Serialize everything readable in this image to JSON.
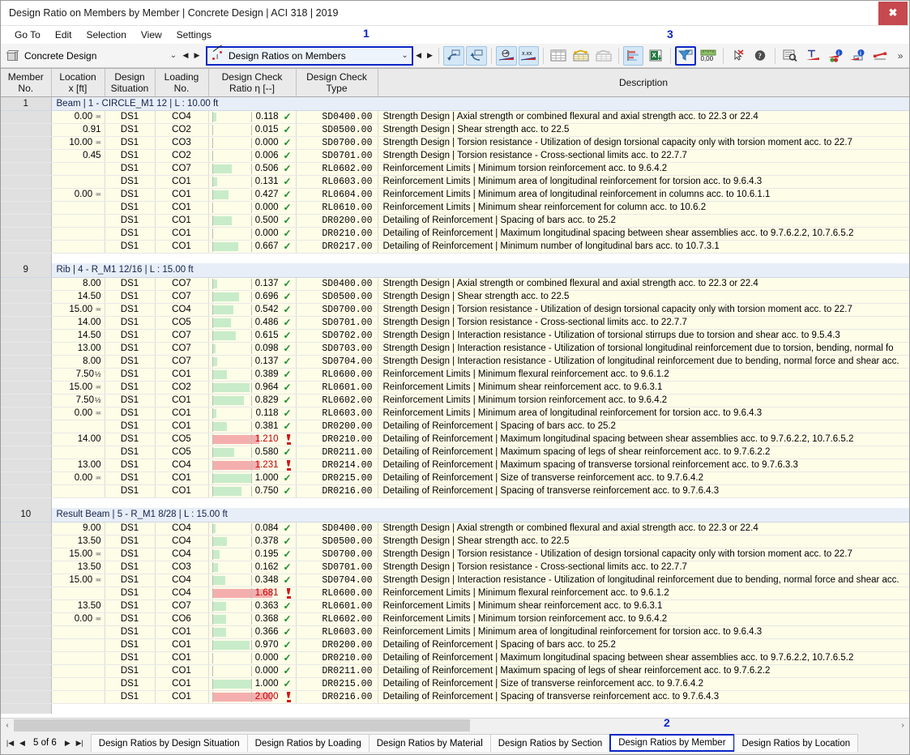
{
  "window": {
    "title": "Design Ratio on Members by Member | Concrete Design | ACI 318 | 2019",
    "close_label": "✖"
  },
  "menubar": {
    "items": [
      "Go To",
      "Edit",
      "Selection",
      "View",
      "Settings"
    ]
  },
  "callouts": {
    "one": "1",
    "two": "2",
    "three": "3"
  },
  "toolbar": {
    "module_combo": {
      "value": "Concrete Design",
      "chevron": "⌄",
      "prev": "◀",
      "next": "▶"
    },
    "table_combo": {
      "value": "Design Ratios on Members",
      "chevron": "⌄",
      "prev": "◀",
      "next": "▶"
    },
    "overflow": "»",
    "buttons": [
      "select-in-graphic-icon",
      "select-in-table-icon",
      "show-results-icon",
      "show-values-icon",
      "table-all-icon",
      "table-filled-icon",
      "table-empty-icon",
      "chart-icon",
      "export-excel-icon",
      "filter-icon",
      "decimal-places-icon",
      "deselect-icon",
      "help-icon",
      "find-icon",
      "units-icon",
      "info-colors-icon",
      "info-marker-icon",
      "reference-icon"
    ]
  },
  "table": {
    "columns": [
      {
        "id": "member_no",
        "label": "Member\nNo."
      },
      {
        "id": "location",
        "label": "Location\nx [ft]"
      },
      {
        "id": "design_situation",
        "label": "Design\nSituation"
      },
      {
        "id": "loading_no",
        "label": "Loading\nNo."
      },
      {
        "id": "design_check_ratio",
        "label": "Design Check\nRatio η [--]"
      },
      {
        "id": "design_check_type",
        "label": "Design Check\nType"
      },
      {
        "id": "description",
        "label": "Description"
      }
    ],
    "groups": [
      {
        "member_no": "1",
        "title": "Beam | 1 - CIRCLE_M1 12 | L : 10.00 ft",
        "rows": [
          {
            "loc": "0.00",
            "sym": "≖",
            "ds": "DS1",
            "lc": "CO4",
            "ratio": "0.118",
            "val": 0.118,
            "ok": true,
            "type": "SD0400.00",
            "desc": "Strength Design | Axial strength or combined flexural and axial strength acc. to 22.3 or 22.4"
          },
          {
            "loc": "0.91",
            "sym": "",
            "ds": "DS1",
            "lc": "CO2",
            "ratio": "0.015",
            "val": 0.015,
            "ok": true,
            "type": "SD0500.00",
            "desc": "Strength Design | Shear strength acc. to 22.5"
          },
          {
            "loc": "10.00",
            "sym": "≖",
            "ds": "DS1",
            "lc": "CO3",
            "ratio": "0.000",
            "val": 0.0,
            "ok": true,
            "type": "SD0700.00",
            "desc": "Strength Design | Torsion resistance - Utilization of design torsional capacity only with torsion moment acc. to 22.7"
          },
          {
            "loc": "0.45",
            "sym": "",
            "ds": "DS1",
            "lc": "CO2",
            "ratio": "0.006",
            "val": 0.006,
            "ok": true,
            "type": "SD0701.00",
            "desc": "Strength Design | Torsion resistance - Cross-sectional limits acc. to 22.7.7"
          },
          {
            "loc": "",
            "sym": "",
            "ds": "DS1",
            "lc": "CO7",
            "ratio": "0.506",
            "val": 0.506,
            "ok": true,
            "type": "RL0602.00",
            "desc": "Reinforcement Limits | Minimum torsion reinforcement acc. to 9.6.4.2"
          },
          {
            "loc": "",
            "sym": "",
            "ds": "DS1",
            "lc": "CO1",
            "ratio": "0.131",
            "val": 0.131,
            "ok": true,
            "type": "RL0603.00",
            "desc": "Reinforcement Limits | Minimum area of longitudinal reinforcement for torsion acc. to 9.6.4.3"
          },
          {
            "loc": "0.00",
            "sym": "≖",
            "ds": "DS1",
            "lc": "CO1",
            "ratio": "0.427",
            "val": 0.427,
            "ok": true,
            "type": "RL0604.00",
            "desc": "Reinforcement Limits | Minimum area of longitudinal reinforcement in columns acc. to 10.6.1.1"
          },
          {
            "loc": "",
            "sym": "",
            "ds": "DS1",
            "lc": "CO1",
            "ratio": "0.000",
            "val": 0.0,
            "ok": true,
            "type": "RL0610.00",
            "desc": "Reinforcement Limits | Minimum shear reinforcement for column acc. to 10.6.2"
          },
          {
            "loc": "",
            "sym": "",
            "ds": "DS1",
            "lc": "CO1",
            "ratio": "0.500",
            "val": 0.5,
            "ok": true,
            "type": "DR0200.00",
            "desc": "Detailing of Reinforcement | Spacing of bars acc. to 25.2"
          },
          {
            "loc": "",
            "sym": "",
            "ds": "DS1",
            "lc": "CO1",
            "ratio": "0.000",
            "val": 0.0,
            "ok": true,
            "type": "DR0210.00",
            "desc": "Detailing of Reinforcement | Maximum longitudinal spacing between shear assemblies acc. to 9.7.6.2.2, 10.7.6.5.2"
          },
          {
            "loc": "",
            "sym": "",
            "ds": "DS1",
            "lc": "CO1",
            "ratio": "0.667",
            "val": 0.667,
            "ok": true,
            "type": "DR0217.00",
            "desc": "Detailing of Reinforcement | Minimum number of longitudinal bars acc. to 10.7.3.1"
          }
        ]
      },
      {
        "member_no": "9",
        "title": "Rib | 4 - R_M1 12/16 | L : 15.00 ft",
        "rows": [
          {
            "loc": "8.00",
            "sym": "",
            "ds": "DS1",
            "lc": "CO7",
            "ratio": "0.137",
            "val": 0.137,
            "ok": true,
            "type": "SD0400.00",
            "desc": "Strength Design | Axial strength or combined flexural and axial strength acc. to 22.3 or 22.4"
          },
          {
            "loc": "14.50",
            "sym": "",
            "ds": "DS1",
            "lc": "CO7",
            "ratio": "0.696",
            "val": 0.696,
            "ok": true,
            "type": "SD0500.00",
            "desc": "Strength Design | Shear strength acc. to 22.5"
          },
          {
            "loc": "15.00",
            "sym": "≖",
            "ds": "DS1",
            "lc": "CO4",
            "ratio": "0.542",
            "val": 0.542,
            "ok": true,
            "type": "SD0700.00",
            "desc": "Strength Design | Torsion resistance - Utilization of design torsional capacity only with torsion moment acc. to 22.7"
          },
          {
            "loc": "14.00",
            "sym": "",
            "ds": "DS1",
            "lc": "CO5",
            "ratio": "0.486",
            "val": 0.486,
            "ok": true,
            "type": "SD0701.00",
            "desc": "Strength Design | Torsion resistance - Cross-sectional limits acc. to 22.7.7"
          },
          {
            "loc": "14.50",
            "sym": "",
            "ds": "DS1",
            "lc": "CO7",
            "ratio": "0.615",
            "val": 0.615,
            "ok": true,
            "type": "SD0702.00",
            "desc": "Strength Design | Interaction resistance - Utilization of torsional stirrups due to torsion and shear acc. to 9.5.4.3"
          },
          {
            "loc": "13.00",
            "sym": "",
            "ds": "DS1",
            "lc": "CO7",
            "ratio": "0.098",
            "val": 0.098,
            "ok": true,
            "type": "SD0703.00",
            "desc": "Strength Design | Interaction resistance - Utilization of torsional longitudinal reinforcement due to torsion, bending, normal fo"
          },
          {
            "loc": "8.00",
            "sym": "",
            "ds": "DS1",
            "lc": "CO7",
            "ratio": "0.137",
            "val": 0.137,
            "ok": true,
            "type": "SD0704.00",
            "desc": "Strength Design | Interaction resistance - Utilization of longitudinal reinforcement due to bending, normal force and shear acc."
          },
          {
            "loc": "7.50",
            "sym": "",
            "half": "½",
            "ds": "DS1",
            "lc": "CO1",
            "ratio": "0.389",
            "val": 0.389,
            "ok": true,
            "type": "RL0600.00",
            "desc": "Reinforcement Limits | Minimum flexural reinforcement acc. to 9.6.1.2"
          },
          {
            "loc": "15.00",
            "sym": "≖",
            "ds": "DS1",
            "lc": "CO2",
            "ratio": "0.964",
            "val": 0.964,
            "ok": true,
            "type": "RL0601.00",
            "desc": "Reinforcement Limits | Minimum shear reinforcement acc. to 9.6.3.1"
          },
          {
            "loc": "7.50",
            "sym": "",
            "half": "½",
            "ds": "DS1",
            "lc": "CO1",
            "ratio": "0.829",
            "val": 0.829,
            "ok": true,
            "type": "RL0602.00",
            "desc": "Reinforcement Limits | Minimum torsion reinforcement acc. to 9.6.4.2"
          },
          {
            "loc": "0.00",
            "sym": "≖",
            "ds": "DS1",
            "lc": "CO1",
            "ratio": "0.118",
            "val": 0.118,
            "ok": true,
            "type": "RL0603.00",
            "desc": "Reinforcement Limits | Minimum area of longitudinal reinforcement for torsion acc. to 9.6.4.3"
          },
          {
            "loc": "",
            "sym": "",
            "ds": "DS1",
            "lc": "CO1",
            "ratio": "0.381",
            "val": 0.381,
            "ok": true,
            "type": "DR0200.00",
            "desc": "Detailing of Reinforcement | Spacing of bars acc. to 25.2"
          },
          {
            "loc": "14.00",
            "sym": "",
            "ds": "DS1",
            "lc": "CO5",
            "ratio": "1.210",
            "val": 1.21,
            "ok": false,
            "type": "DR0210.00",
            "desc": "Detailing of Reinforcement | Maximum longitudinal spacing between shear assemblies acc. to 9.7.6.2.2, 10.7.6.5.2"
          },
          {
            "loc": "",
            "sym": "",
            "ds": "DS1",
            "lc": "CO5",
            "ratio": "0.580",
            "val": 0.58,
            "ok": true,
            "type": "DR0211.00",
            "desc": "Detailing of Reinforcement | Maximum spacing of legs of shear reinforcement acc. to 9.7.6.2.2"
          },
          {
            "loc": "13.00",
            "sym": "",
            "ds": "DS1",
            "lc": "CO4",
            "ratio": "1.231",
            "val": 1.231,
            "ok": false,
            "type": "DR0214.00",
            "desc": "Detailing of Reinforcement | Maximum spacing of transverse torsional reinforcement acc. to 9.7.6.3.3"
          },
          {
            "loc": "0.00",
            "sym": "≖",
            "ds": "DS1",
            "lc": "CO1",
            "ratio": "1.000",
            "val": 1.0,
            "ok": true,
            "type": "DR0215.00",
            "desc": "Detailing of Reinforcement | Size of transverse reinforcement acc. to 9.7.6.4.2"
          },
          {
            "loc": "",
            "sym": "",
            "ds": "DS1",
            "lc": "CO1",
            "ratio": "0.750",
            "val": 0.75,
            "ok": true,
            "type": "DR0216.00",
            "desc": "Detailing of Reinforcement | Spacing of transverse reinforcement acc. to 9.7.6.4.3"
          }
        ]
      },
      {
        "member_no": "10",
        "title": "Result Beam | 5 - R_M1 8/28 | L : 15.00 ft",
        "rows": [
          {
            "loc": "9.00",
            "sym": "",
            "ds": "DS1",
            "lc": "CO4",
            "ratio": "0.084",
            "val": 0.084,
            "ok": true,
            "type": "SD0400.00",
            "desc": "Strength Design | Axial strength or combined flexural and axial strength acc. to 22.3 or 22.4"
          },
          {
            "loc": "13.50",
            "sym": "",
            "ds": "DS1",
            "lc": "CO4",
            "ratio": "0.378",
            "val": 0.378,
            "ok": true,
            "type": "SD0500.00",
            "desc": "Strength Design | Shear strength acc. to 22.5"
          },
          {
            "loc": "15.00",
            "sym": "≖",
            "ds": "DS1",
            "lc": "CO4",
            "ratio": "0.195",
            "val": 0.195,
            "ok": true,
            "type": "SD0700.00",
            "desc": "Strength Design | Torsion resistance - Utilization of design torsional capacity only with torsion moment acc. to 22.7"
          },
          {
            "loc": "13.50",
            "sym": "",
            "ds": "DS1",
            "lc": "CO3",
            "ratio": "0.162",
            "val": 0.162,
            "ok": true,
            "type": "SD0701.00",
            "desc": "Strength Design | Torsion resistance - Cross-sectional limits acc. to 22.7.7"
          },
          {
            "loc": "15.00",
            "sym": "≖",
            "ds": "DS1",
            "lc": "CO4",
            "ratio": "0.348",
            "val": 0.348,
            "ok": true,
            "type": "SD0704.00",
            "desc": "Strength Design | Interaction resistance - Utilization of longitudinal reinforcement due to bending, normal force and shear acc."
          },
          {
            "loc": "",
            "sym": "",
            "ds": "DS1",
            "lc": "CO4",
            "ratio": "1.681",
            "val": 1.681,
            "ok": false,
            "type": "RL0600.00",
            "desc": "Reinforcement Limits | Minimum flexural reinforcement acc. to 9.6.1.2"
          },
          {
            "loc": "13.50",
            "sym": "",
            "ds": "DS1",
            "lc": "CO7",
            "ratio": "0.363",
            "val": 0.363,
            "ok": true,
            "type": "RL0601.00",
            "desc": "Reinforcement Limits | Minimum shear reinforcement acc. to 9.6.3.1"
          },
          {
            "loc": "0.00",
            "sym": "≖",
            "ds": "DS1",
            "lc": "CO6",
            "ratio": "0.368",
            "val": 0.368,
            "ok": true,
            "type": "RL0602.00",
            "desc": "Reinforcement Limits | Minimum torsion reinforcement acc. to 9.6.4.2"
          },
          {
            "loc": "",
            "sym": "",
            "ds": "DS1",
            "lc": "CO1",
            "ratio": "0.366",
            "val": 0.366,
            "ok": true,
            "type": "RL0603.00",
            "desc": "Reinforcement Limits | Minimum area of longitudinal reinforcement for torsion acc. to 9.6.4.3"
          },
          {
            "loc": "",
            "sym": "",
            "ds": "DS1",
            "lc": "CO1",
            "ratio": "0.970",
            "val": 0.97,
            "ok": true,
            "type": "DR0200.00",
            "desc": "Detailing of Reinforcement | Spacing of bars acc. to 25.2"
          },
          {
            "loc": "",
            "sym": "",
            "ds": "DS1",
            "lc": "CO1",
            "ratio": "0.000",
            "val": 0.0,
            "ok": true,
            "type": "DR0210.00",
            "desc": "Detailing of Reinforcement | Maximum longitudinal spacing between shear assemblies acc. to 9.7.6.2.2, 10.7.6.5.2"
          },
          {
            "loc": "",
            "sym": "",
            "ds": "DS1",
            "lc": "CO1",
            "ratio": "0.000",
            "val": 0.0,
            "ok": true,
            "type": "DR0211.00",
            "desc": "Detailing of Reinforcement | Maximum spacing of legs of shear reinforcement acc. to 9.7.6.2.2"
          },
          {
            "loc": "",
            "sym": "",
            "ds": "DS1",
            "lc": "CO1",
            "ratio": "1.000",
            "val": 1.0,
            "ok": true,
            "type": "DR0215.00",
            "desc": "Detailing of Reinforcement | Size of transverse reinforcement acc. to 9.7.6.4.2"
          },
          {
            "loc": "",
            "sym": "",
            "ds": "DS1",
            "lc": "CO1",
            "ratio": "2.000",
            "val": 2.0,
            "ok": false,
            "type": "DR0216.00",
            "desc": "Detailing of Reinforcement | Spacing of transverse reinforcement acc. to 9.7.6.4.3"
          }
        ]
      }
    ]
  },
  "scrollbar": {
    "left_arrow": "‹",
    "right_arrow": "›"
  },
  "statusbar": {
    "page_first": "|◀",
    "page_prev": "◀",
    "page_text": "5 of 6",
    "page_next": "▶",
    "page_last": "▶|",
    "tabs": [
      {
        "label": "Design Ratios by Design Situation",
        "active": false
      },
      {
        "label": "Design Ratios by Loading",
        "active": false
      },
      {
        "label": "Design Ratios by Material",
        "active": false
      },
      {
        "label": "Design Ratios by Section",
        "active": false
      },
      {
        "label": "Design Ratios by Member",
        "active": true
      },
      {
        "label": "Design Ratios by Location",
        "active": false
      }
    ]
  },
  "colors": {
    "accent_blue": "#0a27c8",
    "bar_ok": "#c8ecca",
    "bar_bad": "#f5aeae",
    "row_bg": "#fdfde8",
    "group_bg": "#e8eef8",
    "check_green": "#1a8a2a",
    "error_red": "#c00000"
  }
}
